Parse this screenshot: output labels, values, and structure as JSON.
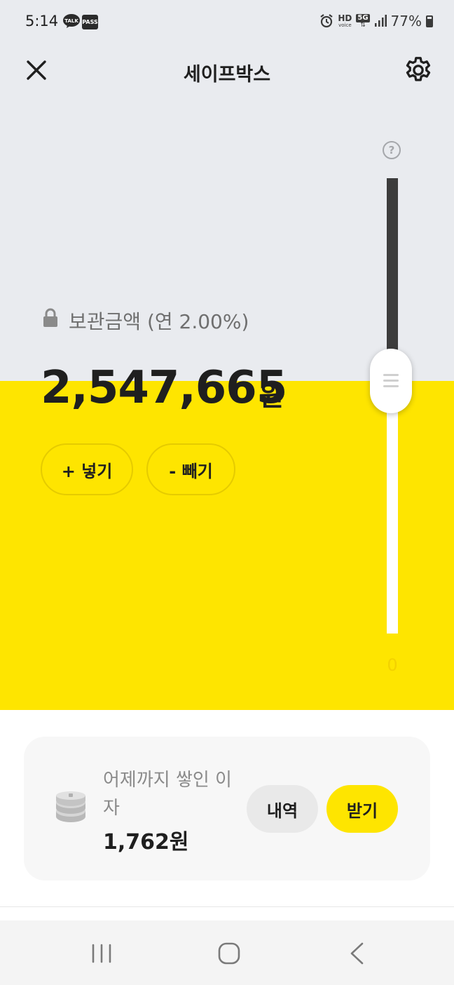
{
  "status_bar": {
    "time": "5:14",
    "talk_badge": "TALK",
    "pass_badge": "PASS",
    "hd_label": "HD",
    "voice_label": "voice",
    "network": "5G",
    "battery": "77%"
  },
  "header": {
    "title": "세이프박스",
    "close_icon": "close-icon",
    "settings_icon": "gear-icon"
  },
  "balance": {
    "label": "보관금액 (연 2.00%)",
    "amount": "2,547,665",
    "unit": "원",
    "deposit_label": "+ 넣기",
    "withdraw_label": "- 빼기"
  },
  "slider": {
    "help": "?",
    "min_label": "0",
    "level": 0.62
  },
  "interest": {
    "label": "어제까지 쌓인 이자",
    "value": "1,762원",
    "history_label": "내역",
    "receive_label": "받기"
  },
  "colors": {
    "brand_yellow": "#fee500",
    "top_background": "#e9ebef",
    "track_dark": "#3c3c3c"
  },
  "navbar": {
    "icons": [
      "recents-icon",
      "home-icon",
      "back-icon"
    ]
  }
}
